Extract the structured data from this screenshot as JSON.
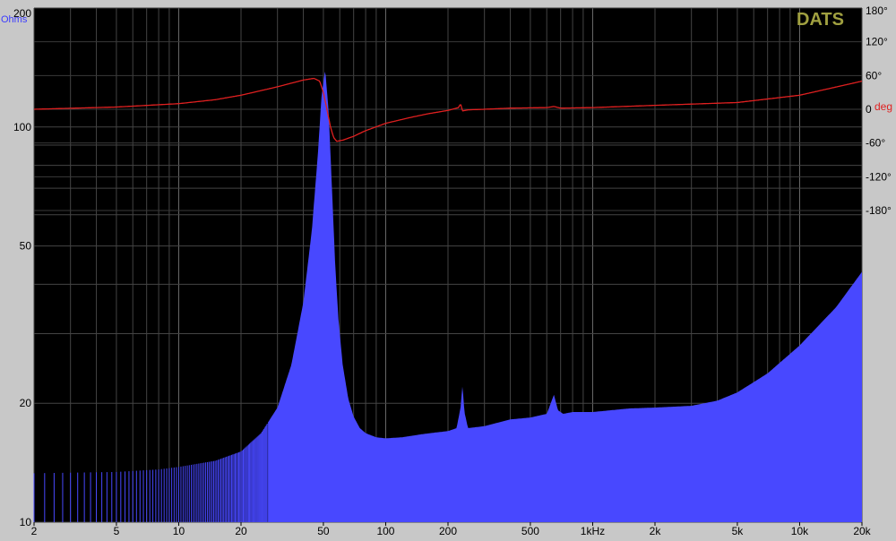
{
  "chart_data": {
    "type": "area",
    "brand": "DATS",
    "x_scale": "log",
    "xlim": [
      2,
      20000
    ],
    "y_scale": "log",
    "ylim": [
      10,
      200
    ],
    "y2lim": [
      -180,
      180
    ],
    "x_ticks": [
      {
        "v": 2,
        "label": "2"
      },
      {
        "v": 5,
        "label": "5"
      },
      {
        "v": 10,
        "label": "10"
      },
      {
        "v": 20,
        "label": "20"
      },
      {
        "v": 50,
        "label": "50"
      },
      {
        "v": 100,
        "label": "100"
      },
      {
        "v": 200,
        "label": "200"
      },
      {
        "v": 500,
        "label": "500"
      },
      {
        "v": 1000,
        "label": "1kHz"
      },
      {
        "v": 2000,
        "label": "2k"
      },
      {
        "v": 5000,
        "label": "5k"
      },
      {
        "v": 10000,
        "label": "10k"
      },
      {
        "v": 20000,
        "label": "20k"
      }
    ],
    "y_ticks": [
      {
        "v": 200,
        "label": "200"
      },
      {
        "v": 100,
        "label": "100"
      },
      {
        "v": 50,
        "label": "50"
      },
      {
        "v": 20,
        "label": "20"
      },
      {
        "v": 10,
        "label": "10"
      }
    ],
    "y2_ticks": [
      {
        "v": 180,
        "label": "180°"
      },
      {
        "v": 120,
        "label": "120°"
      },
      {
        "v": 60,
        "label": "60°"
      },
      {
        "v": 0,
        "label": "0"
      },
      {
        "v": -60,
        "label": "-60°"
      },
      {
        "v": -120,
        "label": "-120°"
      },
      {
        "v": -180,
        "label": "-180°"
      }
    ],
    "ylabel": "Ohms",
    "y2label": "deg",
    "grid": true,
    "series": [
      {
        "name": "Ohms",
        "color": "#4848ff",
        "x": [
          2,
          5,
          8,
          10,
          15,
          20,
          25,
          30,
          35,
          40,
          44,
          47,
          49,
          51,
          53,
          55,
          57,
          59,
          62,
          66,
          70,
          75,
          80,
          90,
          100,
          120,
          150,
          180,
          200,
          220,
          230,
          235,
          240,
          250,
          300,
          400,
          500,
          600,
          650,
          680,
          720,
          800,
          1000,
          1500,
          2000,
          3000,
          4000,
          5000,
          7000,
          10000,
          15000,
          20000
        ],
        "y": [
          13.3,
          13.4,
          13.6,
          13.8,
          14.3,
          15.1,
          16.8,
          19.5,
          25.0,
          36.0,
          55.0,
          85.0,
          120.0,
          140.0,
          110.0,
          70.0,
          45.0,
          33.0,
          25.0,
          20.5,
          18.5,
          17.3,
          16.8,
          16.4,
          16.3,
          16.4,
          16.7,
          16.9,
          17.0,
          17.3,
          19.5,
          22.3,
          19.0,
          17.3,
          17.5,
          18.2,
          18.4,
          18.8,
          21.0,
          19.2,
          18.8,
          19.0,
          19.0,
          19.4,
          19.5,
          19.7,
          20.3,
          21.3,
          23.8,
          28.0,
          35.0,
          43.0
        ]
      },
      {
        "name": "deg",
        "color": "#e02020",
        "x": [
          2,
          5,
          10,
          15,
          20,
          30,
          40,
          45,
          48,
          50,
          52,
          54,
          56,
          58,
          62,
          70,
          80,
          100,
          130,
          160,
          200,
          225,
          230,
          235,
          250,
          300,
          400,
          600,
          650,
          700,
          1000,
          2000,
          5000,
          10000,
          20000
        ],
        "y": [
          0,
          4,
          10,
          17,
          25,
          40,
          52,
          55,
          50,
          30,
          0,
          -30,
          -50,
          -57,
          -55,
          -48,
          -38,
          -25,
          -15,
          -8,
          -2,
          3,
          10,
          -3,
          -1,
          0,
          2,
          3,
          5,
          2,
          3,
          7,
          12,
          25,
          50
        ]
      }
    ]
  }
}
